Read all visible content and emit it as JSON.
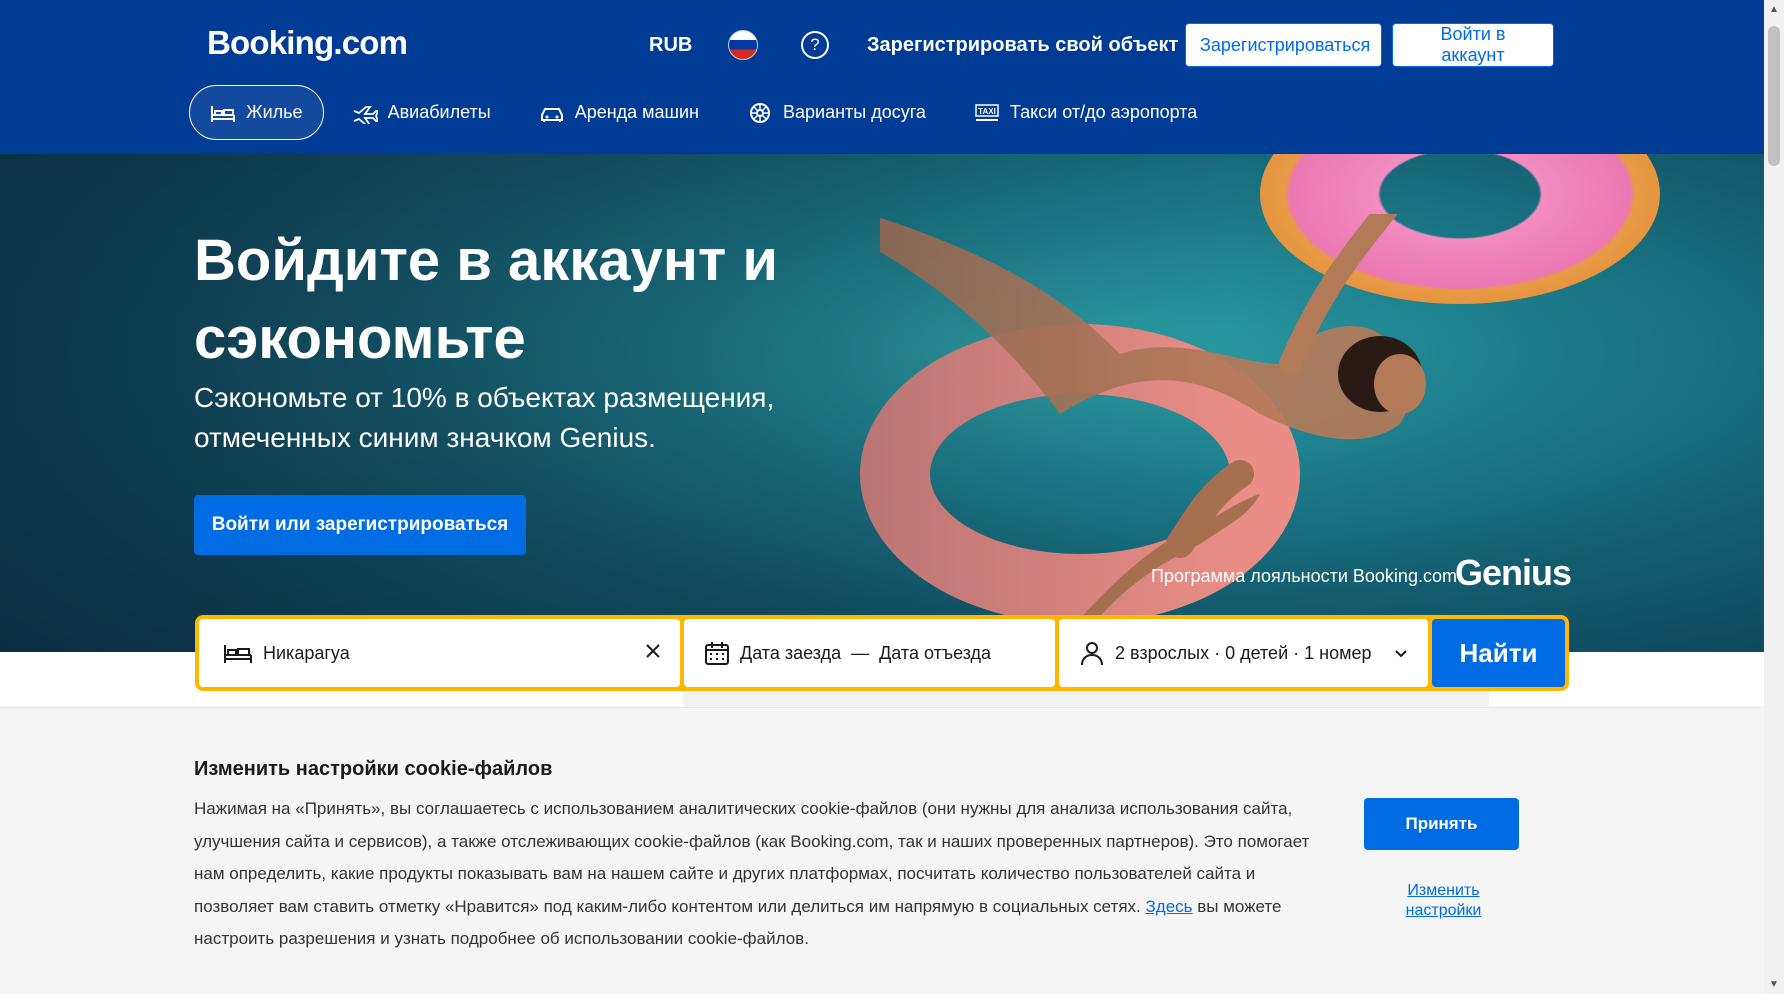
{
  "header": {
    "logo": "Booking.com",
    "currency": "RUB",
    "help_icon": "?",
    "list_property": "Зарегистрировать свой объект",
    "register": "Зарегистрироваться",
    "sign_in": "Войти в аккаунт"
  },
  "nav": {
    "items": [
      {
        "label": "Жилье",
        "icon": "bed-icon",
        "active": true
      },
      {
        "label": "Авиабилеты",
        "icon": "plane-icon",
        "active": false
      },
      {
        "label": "Аренда машин",
        "icon": "car-icon",
        "active": false
      },
      {
        "label": "Варианты досуга",
        "icon": "attractions-icon",
        "active": false
      },
      {
        "label": "Такси от/до аэропорта",
        "icon": "taxi-icon",
        "active": false
      }
    ]
  },
  "hero": {
    "title": "Войдите в аккаунт и сэкономьте",
    "subtitle": "Сэкономьте от 10% в объектах размещения, отмеченных синим значком Genius.",
    "button": "Войти или зарегистрироваться",
    "genius_label": "Программа лояльности Booking.com",
    "genius_logo": "Genius"
  },
  "search": {
    "destination_value": "Никарагуа",
    "checkin": "Дата заезда",
    "dash": "—",
    "checkout": "Дата отъезда",
    "guests": "2 взрослых · 0 детей · 1 номер",
    "button": "Найти"
  },
  "cookie": {
    "title": "Изменить настройки cookie-файлов",
    "text_before_link": "Нажимая на «Принять», вы соглашаетесь с использованием аналитических cookie-файлов (они нужны для анализа использования сайта, улучшения сайта и сервисов), а также отслеживающих cookie-файлов (как Booking.com, так и наших проверенных партнеров). Это помогает нам определить, какие продукты показывать вам на нашем сайте и других платформах, посчитать количество пользователей сайта и позволяет вам ставить отметку «Нравится» под каким-либо контентом или делиться им напрямую в социальных сетях. ",
    "link": "Здесь",
    "text_after_link": " вы можете настроить разрешения и узнать подробнее об использовании cookie-файлов.",
    "accept": "Принять",
    "change": "Изменить настройки"
  },
  "colors": {
    "brand_blue": "#003b95",
    "action_blue": "#006ce4",
    "search_border": "#ffb700"
  }
}
